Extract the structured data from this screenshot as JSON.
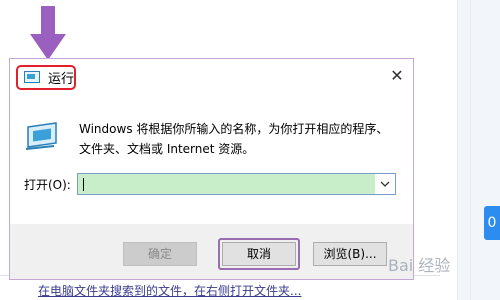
{
  "dialog": {
    "title": "运行",
    "description": "Windows 将根据你所输入的名称，为你打开相应的程序、文件夹、文档或 Internet 资源。",
    "open_label": "打开(O):",
    "open_value": "",
    "buttons": {
      "ok": "确定",
      "cancel": "取消",
      "browse": "浏览(B)..."
    },
    "close": "✕"
  },
  "background": {
    "badge_text": "0",
    "bottom_text": "在电脑文件夹搜索到的文件，在右侧打开文件夹..."
  },
  "watermark": "Bai 经验",
  "colors": {
    "highlight_red": "#e0202a",
    "arrow_purple": "#9b5fc0",
    "input_green": "#c8eec9"
  }
}
